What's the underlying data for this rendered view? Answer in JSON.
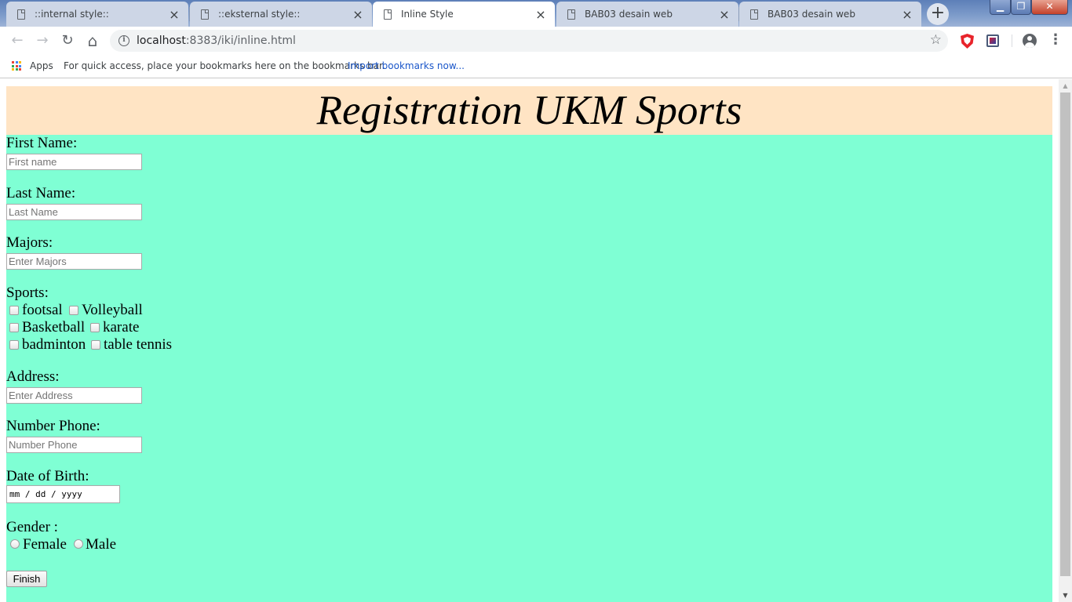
{
  "browser": {
    "tabs": [
      {
        "title": "::internal style::",
        "active": false
      },
      {
        "title": "::eksternal style::",
        "active": false
      },
      {
        "title": "Inline Style",
        "active": true
      },
      {
        "title": "BAB03 desain web",
        "active": false
      },
      {
        "title": "BAB03 desain web",
        "active": false
      }
    ],
    "tab_close": "×",
    "new_tab": "+",
    "window_controls": {
      "minimize": "▁",
      "maximize": "❐",
      "close": "✕"
    },
    "nav": {
      "back": "←",
      "forward": "→",
      "reload": "↻",
      "home": "⌂"
    },
    "address": {
      "host": "localhost",
      "rest": ":8383/iki/inline.html"
    },
    "star": "☆",
    "menu": "⋮",
    "bookmarks_bar": {
      "apps_label": "Apps",
      "hint": "For quick access, place your bookmarks here on the bookmarks bar.",
      "import_link": "Import bookmarks now..."
    },
    "apps_icon_colors": [
      "#ea4335",
      "#4285f4",
      "#fbbc05",
      "#34a853",
      "#ea4335",
      "#4285f4",
      "#fbbc05",
      "#34a853",
      "#ea4335"
    ]
  },
  "page": {
    "heading": "Registration UKM Sports",
    "colors": {
      "header_bg": "#ffe4c4",
      "form_bg": "#7fffd4"
    },
    "first_name": {
      "label": "First Name:",
      "placeholder": "First name"
    },
    "last_name": {
      "label": "Last Name:",
      "placeholder": "Last Name"
    },
    "majors": {
      "label": "Majors:",
      "placeholder": "Enter Majors"
    },
    "sports": {
      "label": "Sports:",
      "options": [
        "footsal",
        "Volleyball",
        "Basketball",
        "karate",
        "badminton",
        "table tennis"
      ]
    },
    "address": {
      "label": "Address:",
      "placeholder": "Enter Address"
    },
    "phone": {
      "label": "Number Phone:",
      "placeholder": "Number Phone"
    },
    "dob": {
      "label": "Date of Birth:",
      "placeholder": "mm / dd / yyyy"
    },
    "gender": {
      "label": "Gender :",
      "options": [
        "Female",
        "Male"
      ]
    },
    "submit_label": "Finish"
  }
}
